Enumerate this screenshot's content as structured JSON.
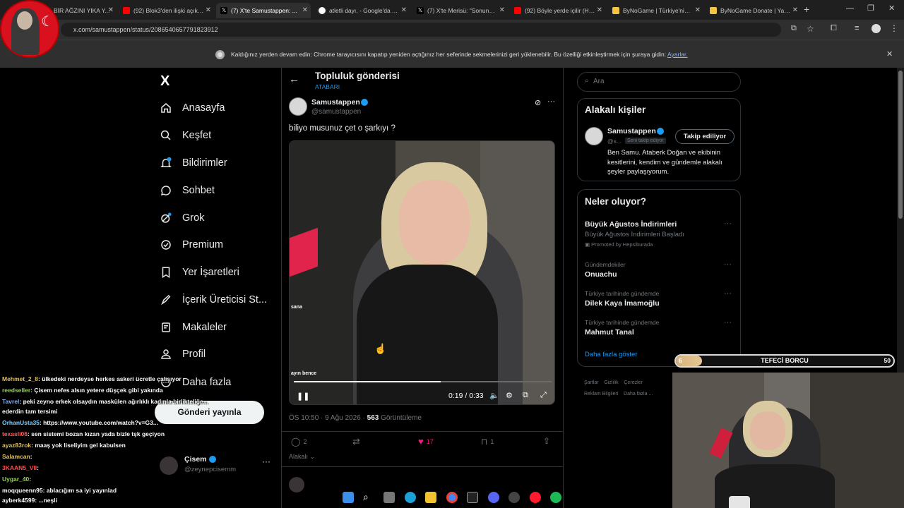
{
  "browser": {
    "tabs": [
      {
        "title": "BİR AĞZINI YIKA Y..."
      },
      {
        "title": "(92) Blok3'den ilişki açıkla..."
      },
      {
        "title": "(7) X'te Samustappen: ...",
        "active": true
      },
      {
        "title": "atletli dayı, - Google'da A..."
      },
      {
        "title": "(7) X'te Merisü: \"Sonunda..."
      },
      {
        "title": "(92) Böyle yerde içilir (Hal..."
      },
      {
        "title": "ByNoGame | Türkiye'nin D..."
      },
      {
        "title": "ByNoGame Donate | Yayı..."
      }
    ],
    "new_tab": "+",
    "url": "x.com/samustappen/status/2086540657791823912",
    "info_message": "Kaldığınız yerden devam edin: Chrome tarayıcısını kapatıp yeniden açtığınız her seferinde sekmelerinizi geri yüklenebilir. Bu özelliği etkinleştirmek için şuraya gidin:",
    "info_link": "Ayarlar."
  },
  "nav": {
    "logo": "X",
    "items": [
      {
        "label": "Anasayfa",
        "icon": "home-icon"
      },
      {
        "label": "Keşfet",
        "icon": "search-icon"
      },
      {
        "label": "Bildirimler",
        "icon": "bell-icon",
        "badge": "7"
      },
      {
        "label": "Sohbet",
        "icon": "chat-icon"
      },
      {
        "label": "Grok",
        "icon": "grok-icon"
      },
      {
        "label": "Premium",
        "icon": "premium-icon"
      },
      {
        "label": "Yer İşaretleri",
        "icon": "bookmark-icon"
      },
      {
        "label": "İçerik Üreticisi St...",
        "icon": "rocket-icon"
      },
      {
        "label": "Makaleler",
        "icon": "article-icon"
      },
      {
        "label": "Profil",
        "icon": "profile-icon"
      },
      {
        "label": "Daha fazla",
        "icon": "more-icon"
      }
    ],
    "post_button": "Gönderi yayınla",
    "account": {
      "name": "Çisem",
      "handle": "@zeynepcisemm"
    }
  },
  "post": {
    "header_title": "Topluluk gönderisi",
    "header_sub": "ATABARI",
    "author_name": "Samustappen",
    "author_handle": "@samustappen",
    "text": "biliyo musunuz çet o şarkıyı ?",
    "video": {
      "time": "0:19 / 0:33",
      "progress": 0.57,
      "overlay_left": "sana",
      "overlay_bottom": "ayın bence"
    },
    "time": "ÖS 10:50 · 9 Ağu 2026",
    "views_count": "563",
    "views_label": "Görüntüleme",
    "replies": "2",
    "likes": "17",
    "bookmarks": "1",
    "related": "Alakalı"
  },
  "sidebar": {
    "search_placeholder": "Ara",
    "related_title": "Alakalı kişiler",
    "person": {
      "name": "Samustappen",
      "handle": "@s...",
      "follows_you": "Seni takip ediyor",
      "follow_button": "Takip ediliyor",
      "bio": "Ben Samu. Ataberk Doğan ve ekibinin kesitlerini, kendim ve gündemle alakalı şeyler paylaşıyorum."
    },
    "trends_title": "Neler oluyor?",
    "trends": [
      {
        "title": "Büyük Ağustos İndirimleri",
        "sub": "Büyük Ağustos İndirimleri Başladı",
        "promo": "Promoted by Hepsiburada"
      },
      {
        "context": "Gündemdekiler",
        "title": "Onuachu"
      },
      {
        "context": "Türkiye tarihinde gündemde",
        "title": "Dilek Kaya İmamoğlu"
      },
      {
        "context": "Türkiye tarihinde gündemde",
        "title": "Mahmut Tanal"
      }
    ],
    "show_more": "Daha fazla göster",
    "footer": [
      "Şartlar",
      "Gizlilik",
      "Çerezler",
      "Reklam Bilgileri",
      "Daha fazla ..."
    ]
  },
  "overlay": {
    "goal_label": "TEFECİ BORCU",
    "goal_current": "6",
    "goal_target": "50",
    "goal_fraction": 0.12,
    "chat": [
      {
        "user": "Mehmet_2_8",
        "color": "#e0c060",
        "text": ": ülkedeki nerdeyse herkes askeri ücretle çalışıyor"
      },
      {
        "user": "reedseller",
        "color": "#9ad05a",
        "text": ": Çisem nefes alsın yetere düşçek gibi yakında"
      },
      {
        "user": "Tavrel",
        "color": "#7fb0ff",
        "text": ": peki zeyno erkek olsaydın maskülen ağırlıklı kadınla birlikteliğe..."
      },
      {
        "user": "",
        "color": "#ffffff",
        "text": "ederdin tam tersimi"
      },
      {
        "user": "OrhanUsta35",
        "color": "#7fd0ff",
        "text": ": https://www.youtube.com/watch?v=G3..."
      },
      {
        "user": "texasli06",
        "color": "#ff6060",
        "text": ": sen sistemi bozan kızan yada bizle tşk geçiyon"
      },
      {
        "user": "ayaz83rok",
        "color": "#e0c060",
        "text": ": maaş yok liseliyim gel kabulsen"
      },
      {
        "user": "Salamcan",
        "color": "#e0c060",
        "text": ":"
      },
      {
        "user": "3KAAN5_VII",
        "color": "#ff5050",
        "text": ":"
      },
      {
        "user": "Uygar_40",
        "color": "#9ad05a",
        "text": ":"
      },
      {
        "user": "moqqueenn95",
        "color": "#ffffff",
        "text": ": ablacığım sa iyi yayınlad"
      },
      {
        "user": "ayberk4599",
        "color": "#ffffff",
        "text": ": ...neşli"
      }
    ]
  },
  "colors": {
    "accent": "#1d9bf0",
    "like": "#f91880",
    "bg": "#000000",
    "border": "#2f3336"
  }
}
